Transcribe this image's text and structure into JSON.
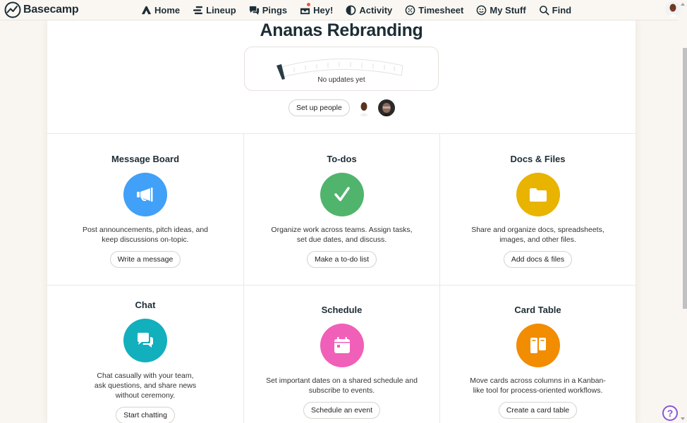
{
  "app": {
    "brand": "Basecamp",
    "brand_icon": "basecamp-logo-icon"
  },
  "nav": {
    "items": [
      {
        "label": "Home",
        "icon": "home-icon"
      },
      {
        "label": "Lineup",
        "icon": "lineup-icon"
      },
      {
        "label": "Pings",
        "icon": "pings-icon"
      },
      {
        "label": "Hey!",
        "icon": "hey-inbox-icon",
        "notification": true
      },
      {
        "label": "Activity",
        "icon": "activity-icon"
      },
      {
        "label": "Timesheet",
        "icon": "timesheet-icon"
      },
      {
        "label": "My Stuff",
        "icon": "smiley-icon"
      },
      {
        "label": "Find",
        "icon": "search-icon"
      }
    ],
    "user_avatar": "current-user-avatar"
  },
  "project": {
    "title": "Ananas Rebranding",
    "hill_chart_status": "No updates yet",
    "setup_people_label": "Set up people",
    "people": [
      "person-1",
      "person-2"
    ]
  },
  "tools": [
    {
      "title": "Message Board",
      "icon": "megaphone-icon",
      "color": "#41a0f7",
      "description": "Post announcements, pitch ideas, and keep discussions on-topic.",
      "button": "Write a message"
    },
    {
      "title": "To-dos",
      "icon": "checkmark-icon",
      "color": "#51b46d",
      "description": "Organize work across teams. Assign tasks, set due dates, and discuss.",
      "button": "Make a to-do list"
    },
    {
      "title": "Docs & Files",
      "icon": "folder-icon",
      "color": "#e8b400",
      "description": "Share and organize docs, spreadsheets, images, and other files.",
      "button": "Add docs & files"
    },
    {
      "title": "Chat",
      "icon": "chat-bubbles-icon",
      "color": "#12b0bd",
      "description": "Chat casually with your team, ask questions, and share news without ceremony.",
      "button": "Start chatting"
    },
    {
      "title": "Schedule",
      "icon": "calendar-icon",
      "color": "#f060b8",
      "description": "Set important dates on a shared schedule and subscribe to events.",
      "button": "Schedule an event"
    },
    {
      "title": "Card Table",
      "icon": "card-table-icon",
      "color": "#f28c00",
      "description": "Move cards across columns in a Kanban-like tool for process-oriented workflows.",
      "button": "Create a card table"
    }
  ],
  "help": {
    "label": "?"
  }
}
